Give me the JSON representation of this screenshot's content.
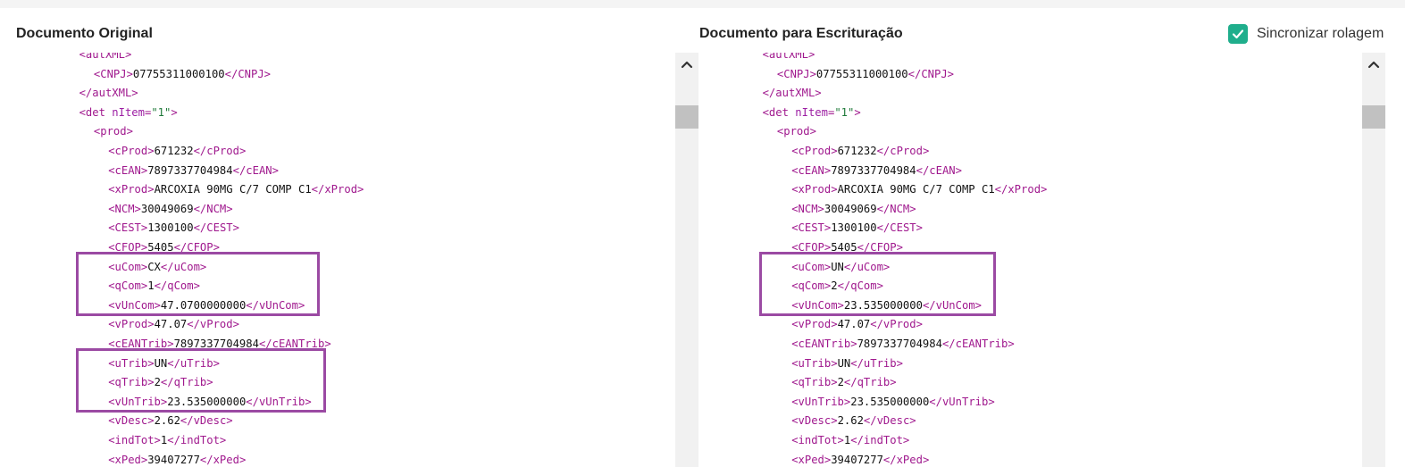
{
  "header": {
    "left_title": "Documento Original",
    "right_title": "Documento para Escrituração",
    "sync_label": "Sincronizar rolagem",
    "sync_checked": true,
    "accent_color": "#1fae8c",
    "highlight_color": "#9b4aa3"
  },
  "icons": {
    "checkbox": "checkmark-icon",
    "scroll_up": "chevron-up-icon"
  },
  "left": {
    "lines": [
      {
        "indent": 2,
        "kind": "cut",
        "text": "<autXML>"
      },
      {
        "indent": 3,
        "kind": "el",
        "tag": "CNPJ",
        "value": "07755311000100"
      },
      {
        "indent": 2,
        "kind": "close",
        "tag": "autXML"
      },
      {
        "indent": 2,
        "kind": "open",
        "tag": "det",
        "attr": "nItem",
        "attr_value": "1"
      },
      {
        "indent": 3,
        "kind": "open",
        "tag": "prod"
      },
      {
        "indent": 4,
        "kind": "el",
        "tag": "cProd",
        "value": "671232"
      },
      {
        "indent": 4,
        "kind": "el",
        "tag": "cEAN",
        "value": "7897337704984"
      },
      {
        "indent": 4,
        "kind": "el",
        "tag": "xProd",
        "value": "ARCOXIA 90MG C/7 COMP C1"
      },
      {
        "indent": 4,
        "kind": "el",
        "tag": "NCM",
        "value": "30049069"
      },
      {
        "indent": 4,
        "kind": "el",
        "tag": "CEST",
        "value": "1300100"
      },
      {
        "indent": 4,
        "kind": "el",
        "tag": "CFOP",
        "value": "5405"
      },
      {
        "indent": 4,
        "kind": "el",
        "tag": "uCom",
        "value": "CX"
      },
      {
        "indent": 4,
        "kind": "el",
        "tag": "qCom",
        "value": "1"
      },
      {
        "indent": 4,
        "kind": "el",
        "tag": "vUnCom",
        "value": "47.0700000000"
      },
      {
        "indent": 4,
        "kind": "el",
        "tag": "vProd",
        "value": "47.07"
      },
      {
        "indent": 4,
        "kind": "el",
        "tag": "cEANTrib",
        "value": "7897337704984"
      },
      {
        "indent": 4,
        "kind": "el",
        "tag": "uTrib",
        "value": "UN"
      },
      {
        "indent": 4,
        "kind": "el",
        "tag": "qTrib",
        "value": "2"
      },
      {
        "indent": 4,
        "kind": "el",
        "tag": "vUnTrib",
        "value": "23.535000000"
      },
      {
        "indent": 4,
        "kind": "el",
        "tag": "vDesc",
        "value": "2.62"
      },
      {
        "indent": 4,
        "kind": "el",
        "tag": "indTot",
        "value": "1"
      },
      {
        "indent": 4,
        "kind": "el",
        "tag": "xPed",
        "value": "39407277"
      }
    ],
    "highlight_groups": [
      [
        11,
        13
      ],
      [
        16,
        18
      ]
    ]
  },
  "right": {
    "lines": [
      {
        "indent": 2,
        "kind": "cut",
        "text": "<autXML>"
      },
      {
        "indent": 3,
        "kind": "el",
        "tag": "CNPJ",
        "value": "07755311000100"
      },
      {
        "indent": 2,
        "kind": "close",
        "tag": "autXML"
      },
      {
        "indent": 2,
        "kind": "open",
        "tag": "det",
        "attr": "nItem",
        "attr_value": "1"
      },
      {
        "indent": 3,
        "kind": "open",
        "tag": "prod"
      },
      {
        "indent": 4,
        "kind": "el",
        "tag": "cProd",
        "value": "671232"
      },
      {
        "indent": 4,
        "kind": "el",
        "tag": "cEAN",
        "value": "7897337704984"
      },
      {
        "indent": 4,
        "kind": "el",
        "tag": "xProd",
        "value": "ARCOXIA 90MG C/7 COMP C1"
      },
      {
        "indent": 4,
        "kind": "el",
        "tag": "NCM",
        "value": "30049069"
      },
      {
        "indent": 4,
        "kind": "el",
        "tag": "CEST",
        "value": "1300100"
      },
      {
        "indent": 4,
        "kind": "el",
        "tag": "CFOP",
        "value": "5405"
      },
      {
        "indent": 4,
        "kind": "el",
        "tag": "uCom",
        "value": "UN"
      },
      {
        "indent": 4,
        "kind": "el",
        "tag": "qCom",
        "value": "2"
      },
      {
        "indent": 4,
        "kind": "el",
        "tag": "vUnCom",
        "value": "23.535000000"
      },
      {
        "indent": 4,
        "kind": "el",
        "tag": "vProd",
        "value": "47.07"
      },
      {
        "indent": 4,
        "kind": "el",
        "tag": "cEANTrib",
        "value": "7897337704984"
      },
      {
        "indent": 4,
        "kind": "el",
        "tag": "uTrib",
        "value": "UN"
      },
      {
        "indent": 4,
        "kind": "el",
        "tag": "qTrib",
        "value": "2"
      },
      {
        "indent": 4,
        "kind": "el",
        "tag": "vUnTrib",
        "value": "23.535000000"
      },
      {
        "indent": 4,
        "kind": "el",
        "tag": "vDesc",
        "value": "2.62"
      },
      {
        "indent": 4,
        "kind": "el",
        "tag": "indTot",
        "value": "1"
      },
      {
        "indent": 4,
        "kind": "el",
        "tag": "xPed",
        "value": "39407277"
      }
    ],
    "highlight_groups": [
      [
        11,
        13
      ]
    ]
  }
}
